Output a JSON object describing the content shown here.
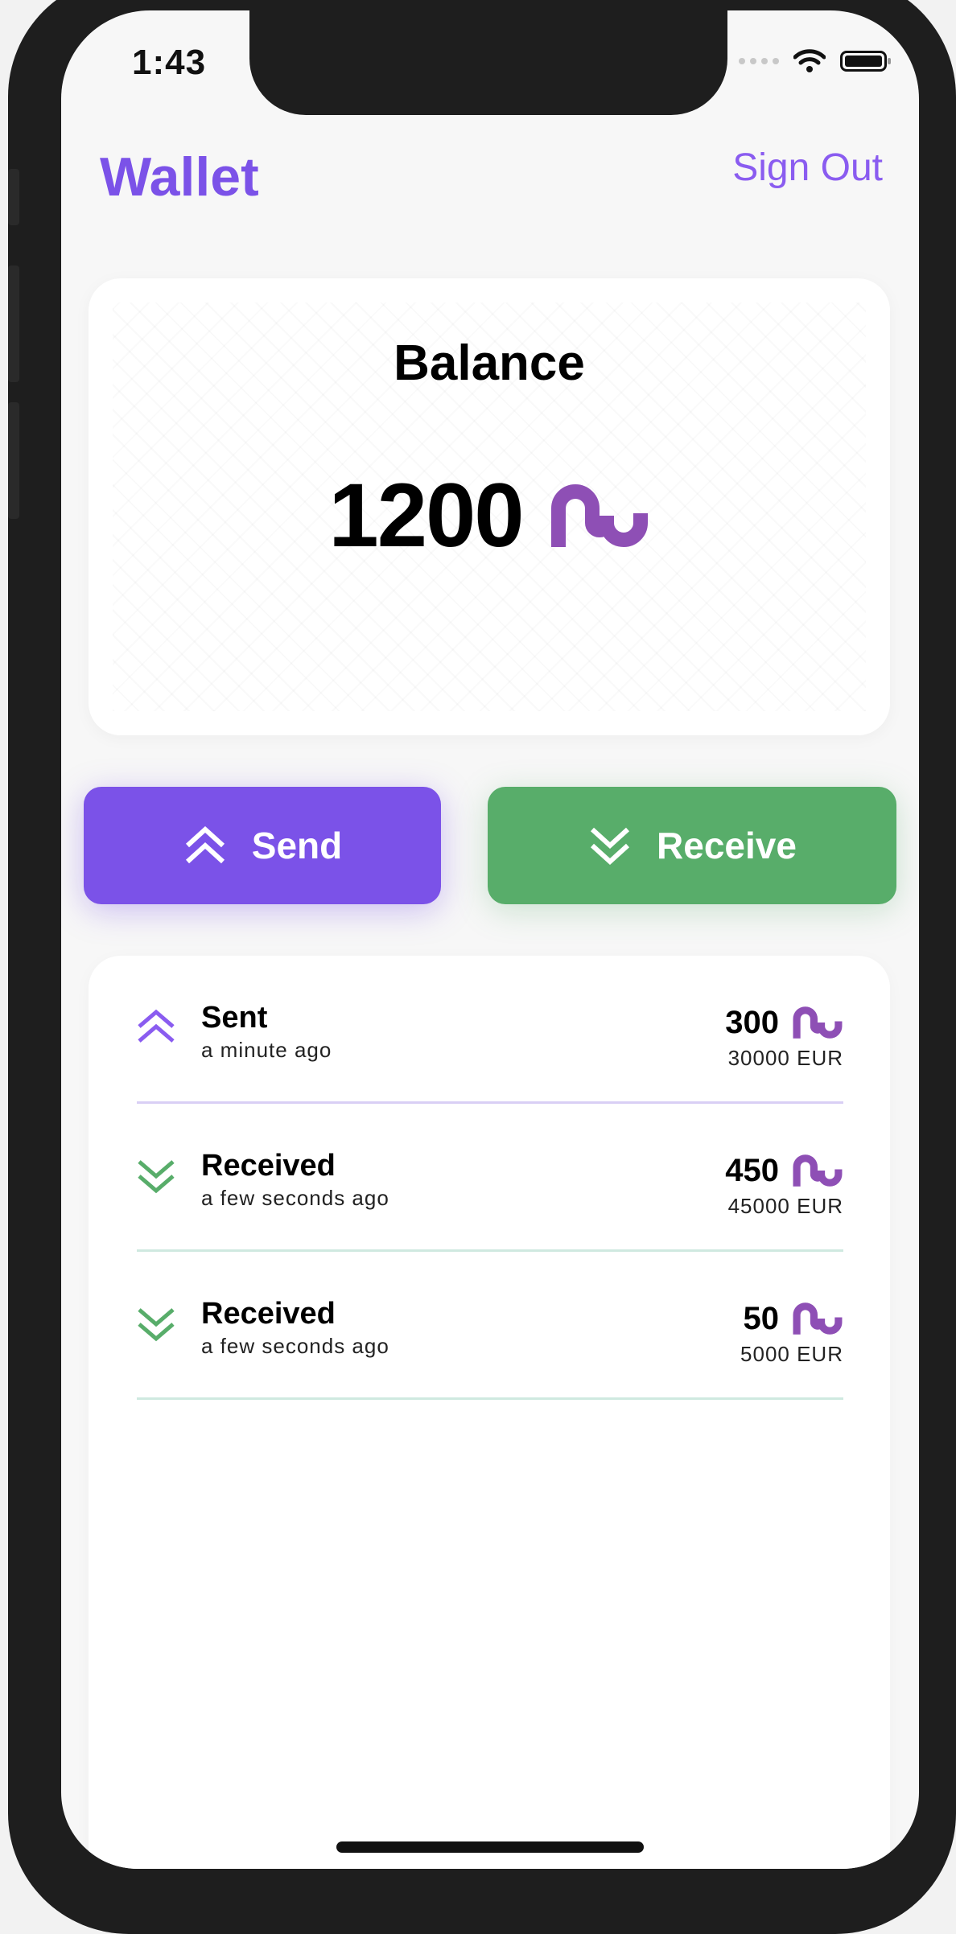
{
  "status_bar": {
    "time": "1:43"
  },
  "header": {
    "title": "Wallet",
    "sign_out_label": "Sign Out"
  },
  "balance": {
    "label": "Balance",
    "amount": "1200",
    "currency_icon": "stumbleupon-coin-icon"
  },
  "actions": {
    "send_label": "Send",
    "receive_label": "Receive",
    "send_color": "#7b52e8",
    "receive_color": "#58ad6a"
  },
  "transactions": [
    {
      "type": "sent",
      "title": "Sent",
      "time": "a minute ago",
      "amount": "300",
      "fiat": "30000 EUR",
      "icon": "chevron-double-up-icon"
    },
    {
      "type": "received",
      "title": "Received",
      "time": "a few seconds ago",
      "amount": "450",
      "fiat": "45000 EUR",
      "icon": "chevron-double-down-icon"
    },
    {
      "type": "received",
      "title": "Received",
      "time": "a few seconds ago",
      "amount": "50",
      "fiat": "5000 EUR",
      "icon": "chevron-double-down-icon"
    }
  ],
  "colors": {
    "accent": "#7b52e8",
    "coin": "#8e4fb5",
    "success": "#58ad6a",
    "sent_divider": "#d9cff5",
    "received_divider": "#cfe9e0"
  }
}
